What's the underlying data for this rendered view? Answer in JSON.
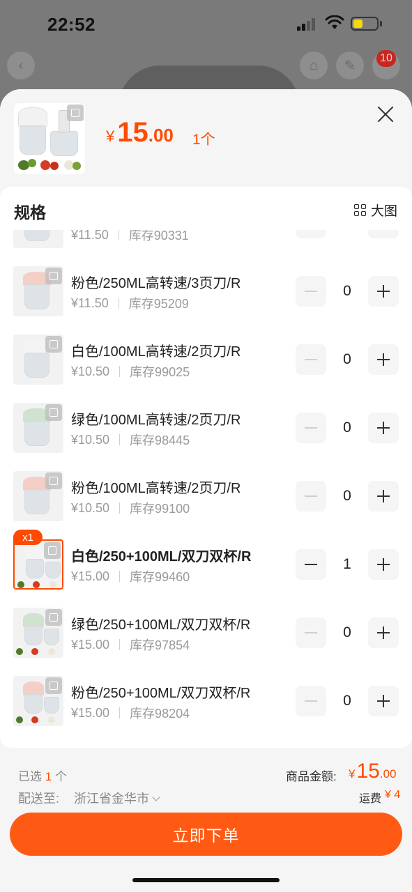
{
  "status_bar": {
    "time": "22:52"
  },
  "background": {
    "cart_badge": "10"
  },
  "header": {
    "currency": "¥",
    "price_int": "15",
    "price_dec": ".00",
    "qty": "1个"
  },
  "spec": {
    "title": "规格",
    "big_image_label": "大图"
  },
  "variants": [
    {
      "name": "",
      "price": "¥11.50",
      "stock": "库存90331",
      "qty": "0",
      "color": "green",
      "selected": false,
      "badge": ""
    },
    {
      "name": "粉色/250ML高转速/3页刀/R",
      "price": "¥11.50",
      "stock": "库存95209",
      "qty": "0",
      "color": "pink",
      "selected": false,
      "badge": ""
    },
    {
      "name": "白色/100ML高转速/2页刀/R",
      "price": "¥10.50",
      "stock": "库存99025",
      "qty": "0",
      "color": "white",
      "selected": false,
      "badge": ""
    },
    {
      "name": "绿色/100ML高转速/2页刀/R",
      "price": "¥10.50",
      "stock": "库存98445",
      "qty": "0",
      "color": "green",
      "selected": false,
      "badge": ""
    },
    {
      "name": "粉色/100ML高转速/2页刀/R",
      "price": "¥10.50",
      "stock": "库存99100",
      "qty": "0",
      "color": "pink",
      "selected": false,
      "badge": ""
    },
    {
      "name": "白色/250+100ML/双刀双杯/R",
      "price": "¥15.00",
      "stock": "库存99460",
      "qty": "1",
      "color": "white",
      "selected": true,
      "badge": "x1"
    },
    {
      "name": "绿色/250+100ML/双刀双杯/R",
      "price": "¥15.00",
      "stock": "库存97854",
      "qty": "0",
      "color": "green",
      "selected": false,
      "badge": ""
    },
    {
      "name": "粉色/250+100ML/双刀双杯/R",
      "price": "¥15.00",
      "stock": "库存98204",
      "qty": "0",
      "color": "pink",
      "selected": false,
      "badge": ""
    }
  ],
  "footer": {
    "selected_prefix": "已选",
    "selected_count": "1",
    "selected_suffix": "个",
    "ship_label": "配送至:",
    "ship_dest": "浙江省金华市",
    "amount_label": "商品金额:",
    "amount_currency": "¥",
    "amount_int": "15",
    "amount_dec": ".00",
    "freight_label": "运费",
    "freight_value": "¥ 4",
    "order_button": "立即下单"
  },
  "colors": {
    "accent": "#ff4a00",
    "button": "#ff5a14",
    "lid_white": "#f4f4f4",
    "lid_green": "#cfe3cf",
    "lid_pink": "#f3cfc6"
  }
}
